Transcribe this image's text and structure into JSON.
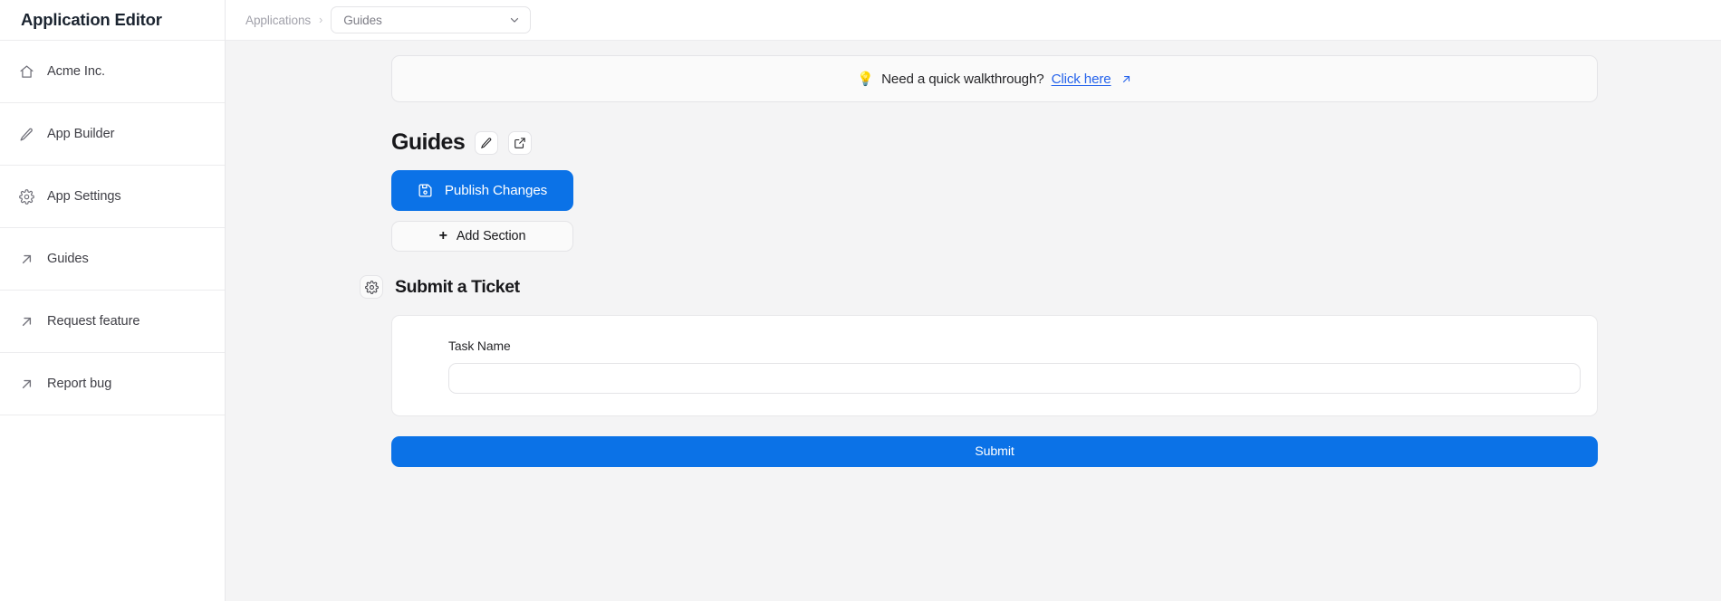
{
  "sidebar": {
    "title": "Application Editor",
    "items": [
      {
        "label": "Acme Inc.",
        "icon": "home-icon"
      },
      {
        "label": "App Builder",
        "icon": "pencil-icon"
      },
      {
        "label": "App Settings",
        "icon": "gear-icon"
      },
      {
        "label": "Guides",
        "icon": "external-link-icon"
      },
      {
        "label": "Request feature",
        "icon": "external-link-icon"
      },
      {
        "label": "Report bug",
        "icon": "external-link-icon"
      }
    ]
  },
  "topbar": {
    "breadcrumb": {
      "root_label": "Applications",
      "separator": "›"
    },
    "app_select": {
      "value": "Guides",
      "icon": "chevron-down-icon"
    }
  },
  "banner": {
    "icon": "lightbulb-emoji",
    "emoji": "💡",
    "text": "Need a quick walkthrough?",
    "link_label": "Click here",
    "link_icon": "external-link-icon"
  },
  "page": {
    "title": "Guides",
    "edit_button_icon": "pencil-icon",
    "open_button_icon": "external-link-icon",
    "publish_label": "Publish Changes",
    "publish_icon": "save-icon",
    "add_section_label": "Add Section",
    "add_section_icon": "plus-icon"
  },
  "section": {
    "settings_icon": "gear-icon",
    "title": "Submit a Ticket",
    "form": {
      "field_label": "Task Name",
      "field_value": "",
      "field_placeholder": "",
      "submit_label": "Submit"
    }
  },
  "colors": {
    "accent_blue": "#0b72e7",
    "link_blue": "#2563eb",
    "page_bg": "#f4f4f5",
    "surface": "#ffffff",
    "border": "#e4e4e7"
  }
}
